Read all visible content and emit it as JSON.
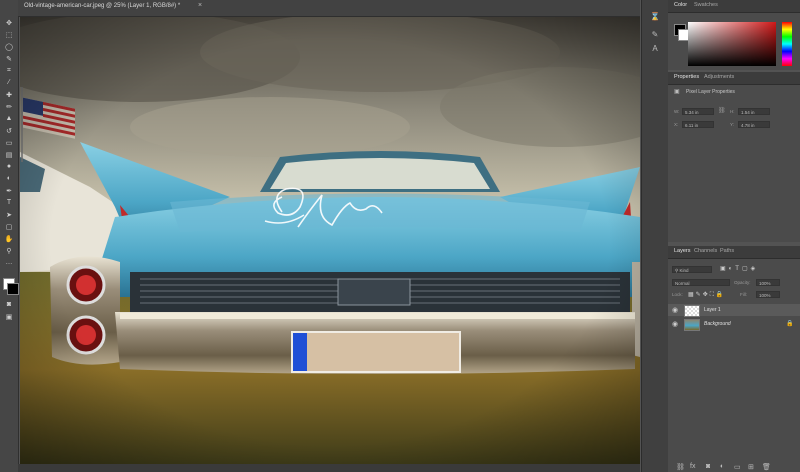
{
  "document_tab": {
    "title": "Old-vintage-american-car.jpeg @ 25% (Layer 1, RGB/8#) *",
    "close": "×"
  },
  "toolbar": {
    "tools": [
      "move",
      "marquee",
      "lasso",
      "quick-select",
      "crop",
      "eyedropper",
      "healing",
      "brush",
      "stamp",
      "history-brush",
      "eraser",
      "gradient",
      "blur",
      "dodge",
      "pen",
      "type",
      "path-select",
      "rectangle",
      "hand",
      "zoom",
      "more"
    ]
  },
  "canvas": {
    "license_plate": "",
    "scribble": "signature"
  },
  "color_panel": {
    "tabs": [
      "Color",
      "Swatches"
    ],
    "foreground": "#000000",
    "background": "#ffffff",
    "accent": "#d01818"
  },
  "properties_panel": {
    "tabs": [
      "Properties",
      "Adjustments"
    ],
    "section": "Pixel Layer Properties",
    "fields": [
      {
        "label": "W:",
        "value": "5.34 in"
      },
      {
        "label": "H:",
        "value": "1.54 in"
      },
      {
        "label": "X:",
        "value": "6.11 in"
      },
      {
        "label": "Y:",
        "value": "4.78 in"
      }
    ]
  },
  "layers_panel": {
    "tabs": [
      "Layers",
      "Channels",
      "Paths"
    ],
    "kind_filter": "Kind",
    "blend_mode": "Normal",
    "opacity_label": "Opacity:",
    "opacity": "100%",
    "lock_label": "Lock:",
    "fill_label": "Fill:",
    "fill": "100%",
    "layers": [
      {
        "name": "Layer 1",
        "selected": true
      },
      {
        "name": "Background",
        "selected": false,
        "locked": true
      }
    ]
  }
}
